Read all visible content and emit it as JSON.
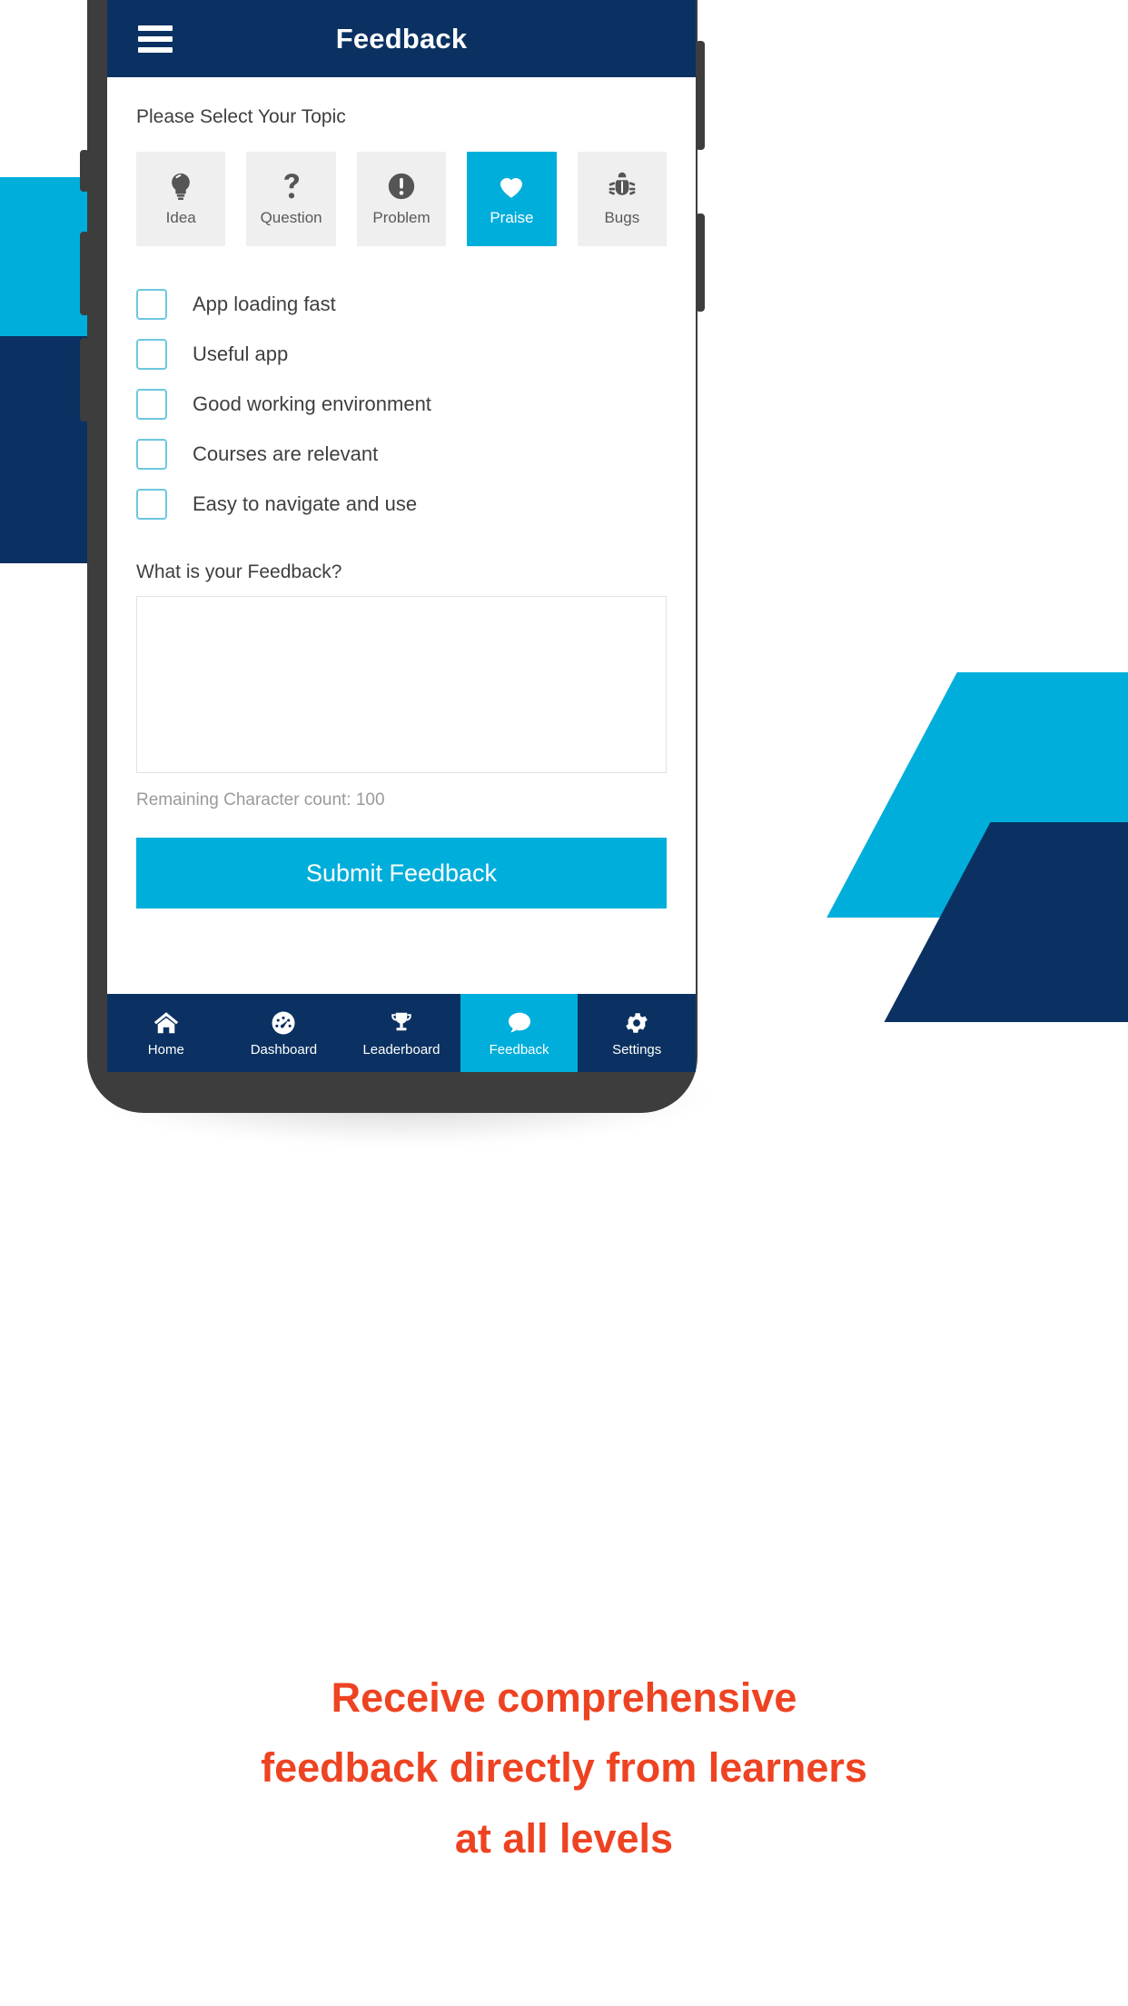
{
  "app": {
    "title": "Feedback",
    "menu_icon": "hamburger-menu-icon"
  },
  "colors": {
    "navy": "#0A3161",
    "cyan": "#00AEDB",
    "orange": "#EE4322",
    "card_gray": "#EFEFEF",
    "frame_gray": "#3D3D3D"
  },
  "topic_section": {
    "label": "Please Select Your Topic",
    "items": [
      {
        "label": "Idea",
        "icon": "lightbulb-icon",
        "selected": false
      },
      {
        "label": "Question",
        "icon": "question-mark-icon",
        "selected": false
      },
      {
        "label": "Problem",
        "icon": "exclamation-circle-icon",
        "selected": false
      },
      {
        "label": "Praise",
        "icon": "heart-icon",
        "selected": true
      },
      {
        "label": "Bugs",
        "icon": "bug-icon",
        "selected": false
      }
    ]
  },
  "checklist": [
    {
      "label": "App loading fast",
      "checked": false
    },
    {
      "label": "Useful app",
      "checked": false
    },
    {
      "label": "Good working environment",
      "checked": false
    },
    {
      "label": "Courses are relevant",
      "checked": false
    },
    {
      "label": "Easy to navigate and use",
      "checked": false
    }
  ],
  "feedback": {
    "label": "What is your Feedback?",
    "value": "",
    "placeholder": "",
    "char_count": "Remaining Character count: 100",
    "submit_label": "Submit Feedback"
  },
  "bottom_nav": [
    {
      "label": "Home",
      "icon": "home-icon",
      "active": false
    },
    {
      "label": "Dashboard",
      "icon": "gauge-icon",
      "active": false
    },
    {
      "label": "Leaderboard",
      "icon": "trophy-icon",
      "active": false
    },
    {
      "label": "Feedback",
      "icon": "chat-bubble-icon",
      "active": true
    },
    {
      "label": "Settings",
      "icon": "gear-icon",
      "active": false
    }
  ],
  "tagline": {
    "line1": "Receive comprehensive",
    "line2": "feedback directly from learners",
    "line3": "at all levels"
  }
}
